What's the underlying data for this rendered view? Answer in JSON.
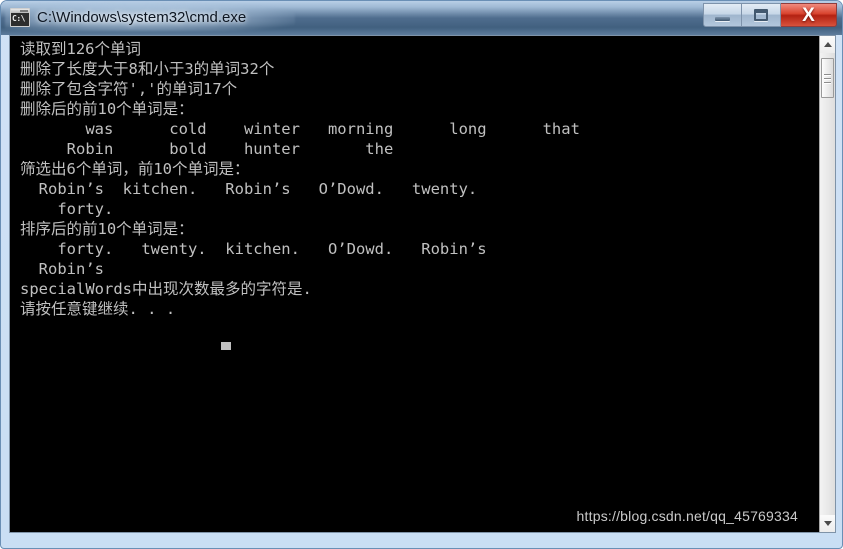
{
  "window": {
    "title": "C:\\Windows\\system32\\cmd.exe",
    "icon_name": "cmd-console-icon",
    "icon_text": "C:\\",
    "buttons": {
      "minimize": "—",
      "maximize": "❐",
      "close": "X"
    }
  },
  "console": {
    "background_color": "#000000",
    "foreground_color": "#c0c0c0",
    "lines": [
      "读取到126个单词",
      "删除了长度大于8和小于3的单词32个",
      "删除了包含字符','的单词17个",
      "删除后的前10个单词是：",
      "       was      cold    winter   morning      long      that",
      "     Robin      bold    hunter       the",
      "筛选出6个单词，前10个单词是：",
      "  Robin’s  kitchen.   Robin’s   O’Dowd.   twenty.",
      "    forty.",
      "排序后的前10个单词是：",
      "    forty.   twenty.  kitchen.   O’Dowd.   Robin’s",
      "  Robin’s",
      "specialWords中出现次数最多的字符是.",
      "请按任意键继续. . ."
    ],
    "cursor": "block",
    "watermark": "https://blog.csdn.net/qq_45769334"
  },
  "scrollbar": {
    "orientation": "vertical",
    "up_arrow": "▲",
    "down_arrow": "▼",
    "thumb_position": "top"
  }
}
